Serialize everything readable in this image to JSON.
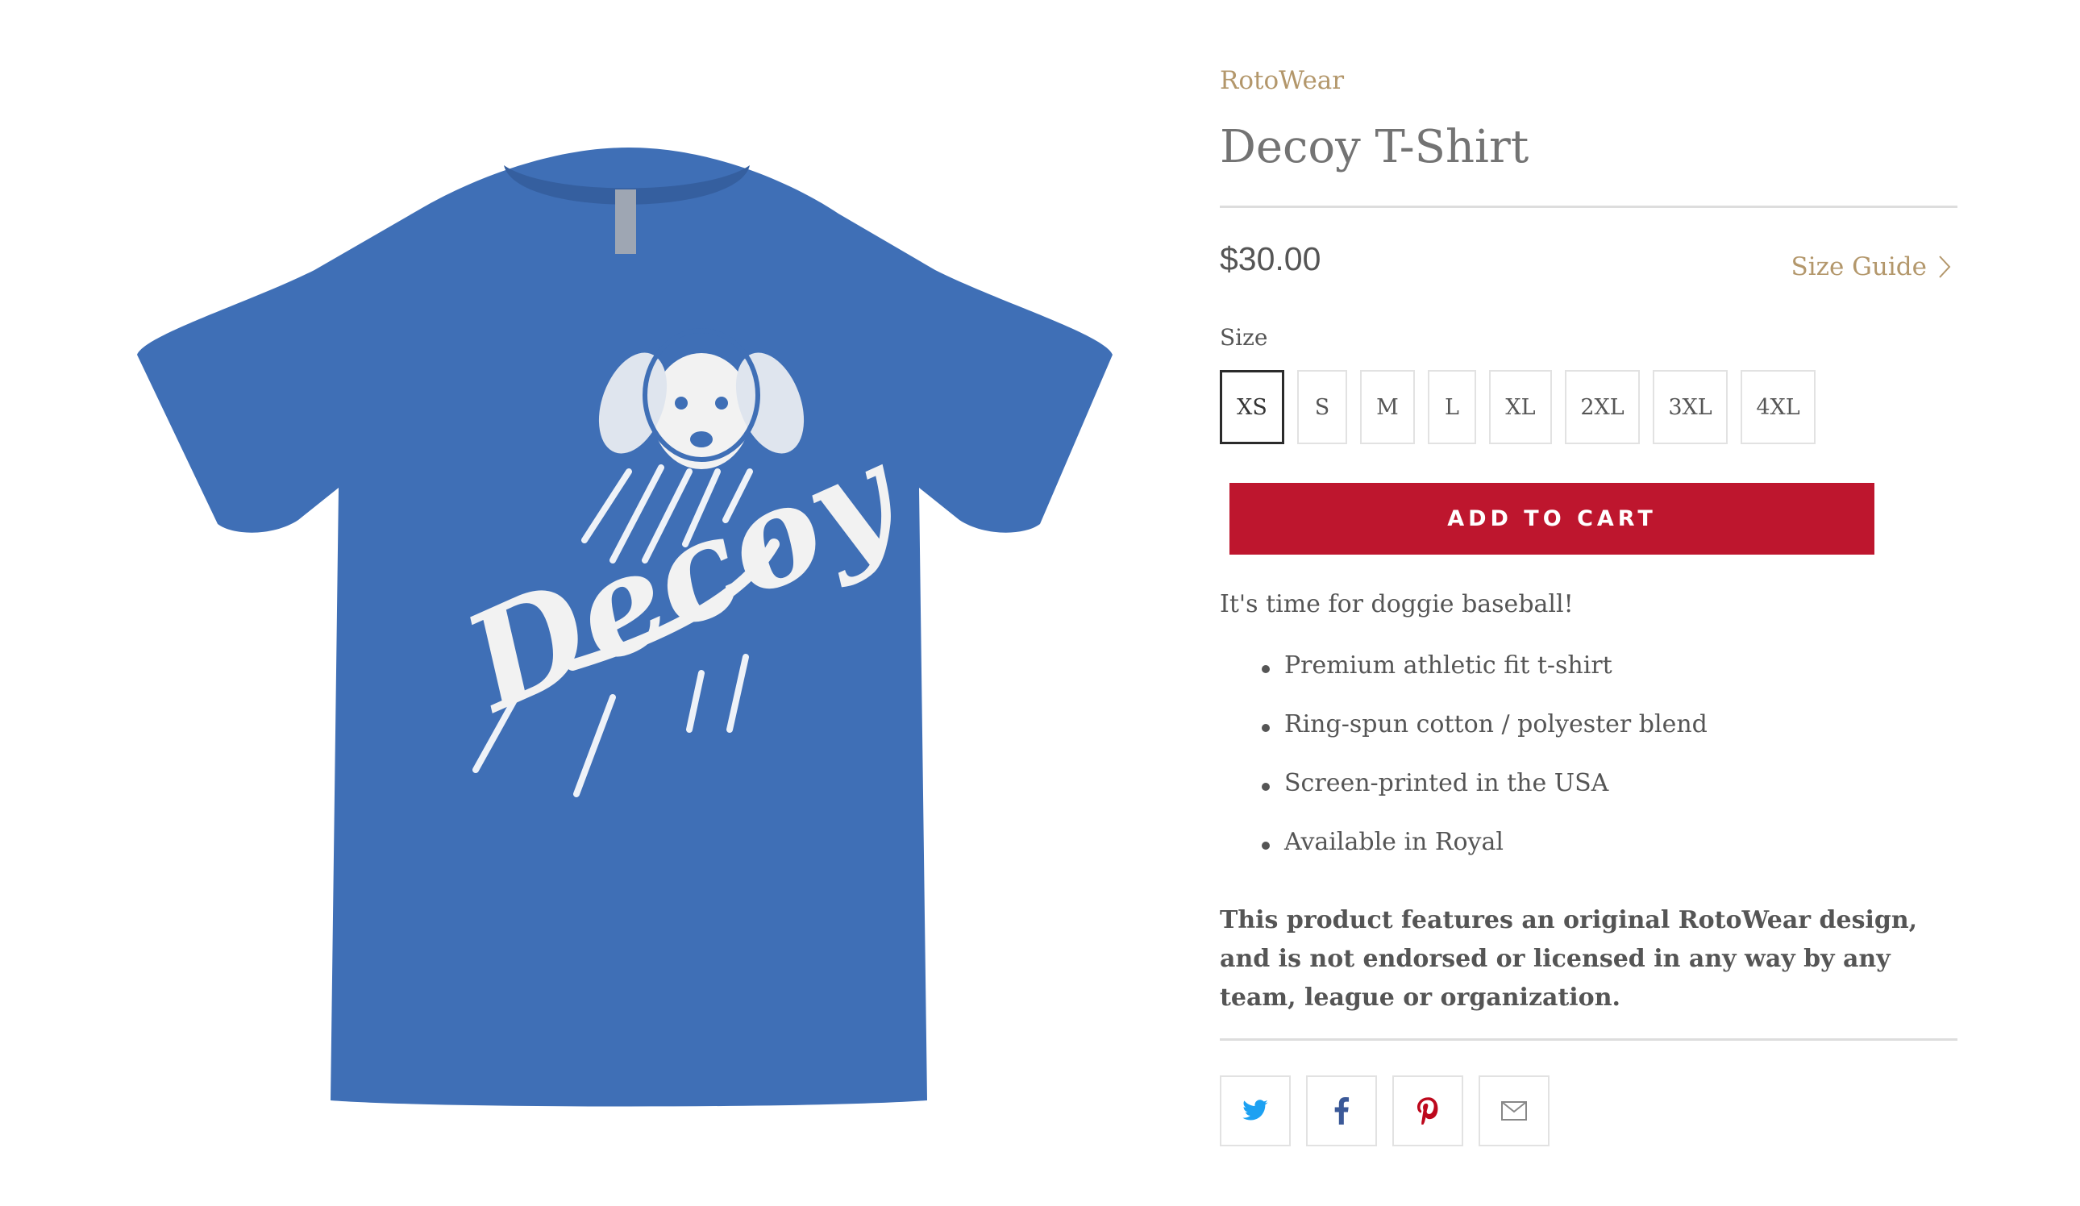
{
  "product": {
    "vendor": "RotoWear",
    "title": "Decoy T-Shirt",
    "price": "$30.00",
    "size_guide": "Size Guide",
    "image_alt": "Decoy",
    "shirt_color": "#3f6fb6"
  },
  "size": {
    "label": "Size",
    "options": [
      "XS",
      "S",
      "M",
      "L",
      "XL",
      "2XL",
      "3XL",
      "4XL"
    ],
    "selected": "XS"
  },
  "cart": {
    "label": "ADD TO CART",
    "color": "#be162e"
  },
  "description": {
    "intro": "It's time for doggie baseball!",
    "features": [
      "Premium athletic fit t-shirt",
      "Ring-spun cotton / polyester blend",
      "Screen-printed in the USA",
      "Available in Royal"
    ],
    "disclaimer": "This product features an original RotoWear design, and is not endorsed or licensed in any way by any team, league or organization."
  },
  "share": [
    {
      "name": "twitter-icon",
      "color": "#1da1f2"
    },
    {
      "name": "facebook-icon",
      "color": "#3b5998"
    },
    {
      "name": "pinterest-icon",
      "color": "#bd081c"
    },
    {
      "name": "email-icon",
      "color": "#888888"
    }
  ],
  "colors": {
    "accent": "#b3976b",
    "text": "#555555"
  }
}
